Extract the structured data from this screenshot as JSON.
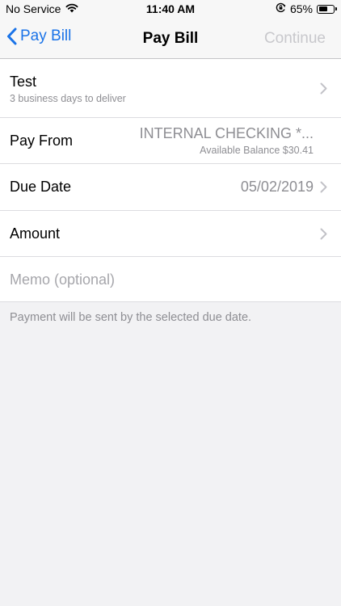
{
  "status_bar": {
    "carrier": "No Service",
    "time": "11:40 AM",
    "battery_percent": "65%",
    "battery_level": 0.65,
    "icons": [
      "wifi-icon",
      "orientation-lock-icon",
      "battery-icon"
    ]
  },
  "nav": {
    "back_label": "Pay Bill",
    "title": "Pay Bill",
    "continue_label": "Continue"
  },
  "payee": {
    "name": "Test",
    "delivery": "3 business days to deliver"
  },
  "pay_from": {
    "label": "Pay From",
    "account": "INTERNAL CHECKING *...",
    "balance": "Available Balance $30.41"
  },
  "due_date": {
    "label": "Due Date",
    "value": "05/02/2019"
  },
  "amount": {
    "label": "Amount"
  },
  "memo": {
    "placeholder": "Memo (optional)"
  },
  "footer": {
    "note": "Payment will be sent by the selected due date."
  },
  "colors": {
    "accent": "#1a73e8",
    "disabled": "#c8c8cc",
    "secondary_text": "#8e8e93",
    "background": "#f2f2f4"
  }
}
